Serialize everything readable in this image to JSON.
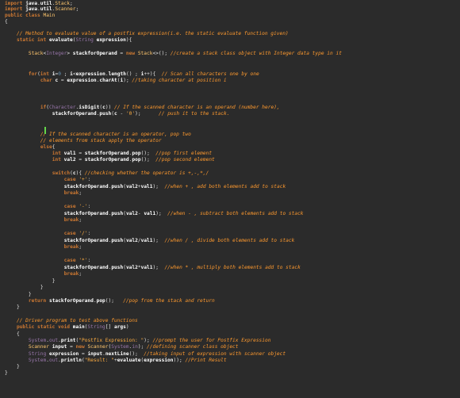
{
  "editor": {
    "language": "java",
    "lines": [
      "import java.util.Stack;",
      "import java.util.Scanner;",
      "public class Main",
      "{",
      "    // Method to evaluate value of a postfix expression(i.e. the static evaluate function given)",
      "    static int evaluate(String expression){",
      "",
      "        Stack<Integer> stackforOperand = new Stack<>(); //create a stack class object with Integer data type in it",
      "",
      "",
      "        for(int i=0 ; i<expression.length() ; i++){  // Scan all characters one by one",
      "            char c = expression.charAt(i); //taking character at position i",
      "",
      "",
      "",
      "            if(Character.isDigit(c)) // If the scanned character is an operand (number here),",
      "                stackforOperand.push(c - '0');      // push it to the stack.",
      "",
      "",
      "            // If the scanned character is an operator, pop two",
      "            // elements from stack apply the operator",
      "            else{",
      "                int val1 = stackforOperand.pop();  //pop first element",
      "                int val2 = stackforOperand.pop();  //pop second element",
      "",
      "                switch(c){ //checking whether the operator is +,-,*,/",
      "                    case '+':",
      "                    stackforOperand.push(val2+val1);  //when + , add both elements add to stack",
      "                    break;",
      "",
      "                    case '-':",
      "                    stackforOperand.push(val2- val1);  //when - , subtract both elements add to stack",
      "                    break;",
      "",
      "                    case '/':",
      "                    stackforOperand.push(val2/val1);  //when / , divide both elements add to stack",
      "                    break;",
      "",
      "                    case '*':",
      "                    stackforOperand.push(val2*val1);  //when * , multiply both elements add to stack",
      "                    break;",
      "                }",
      "            }",
      "        }",
      "        return stackforOperand.pop();   //pop from the stack and return",
      "    }",
      "",
      "    // Driver program to test above functions",
      "    public static void main(String[] args)",
      "    {",
      "        System.out.print(\"Postfix Expression: \"); //prompt the user for Postfix Expression",
      "        Scanner input = new Scanner(System.in); //defining scanner class object",
      "        String expression = input.nextLine();  //taking input of expression with scanner object",
      "        System.out.println(\"Result: \"+evaluate(expression)); //Print Result",
      "    }",
      "}"
    ]
  }
}
